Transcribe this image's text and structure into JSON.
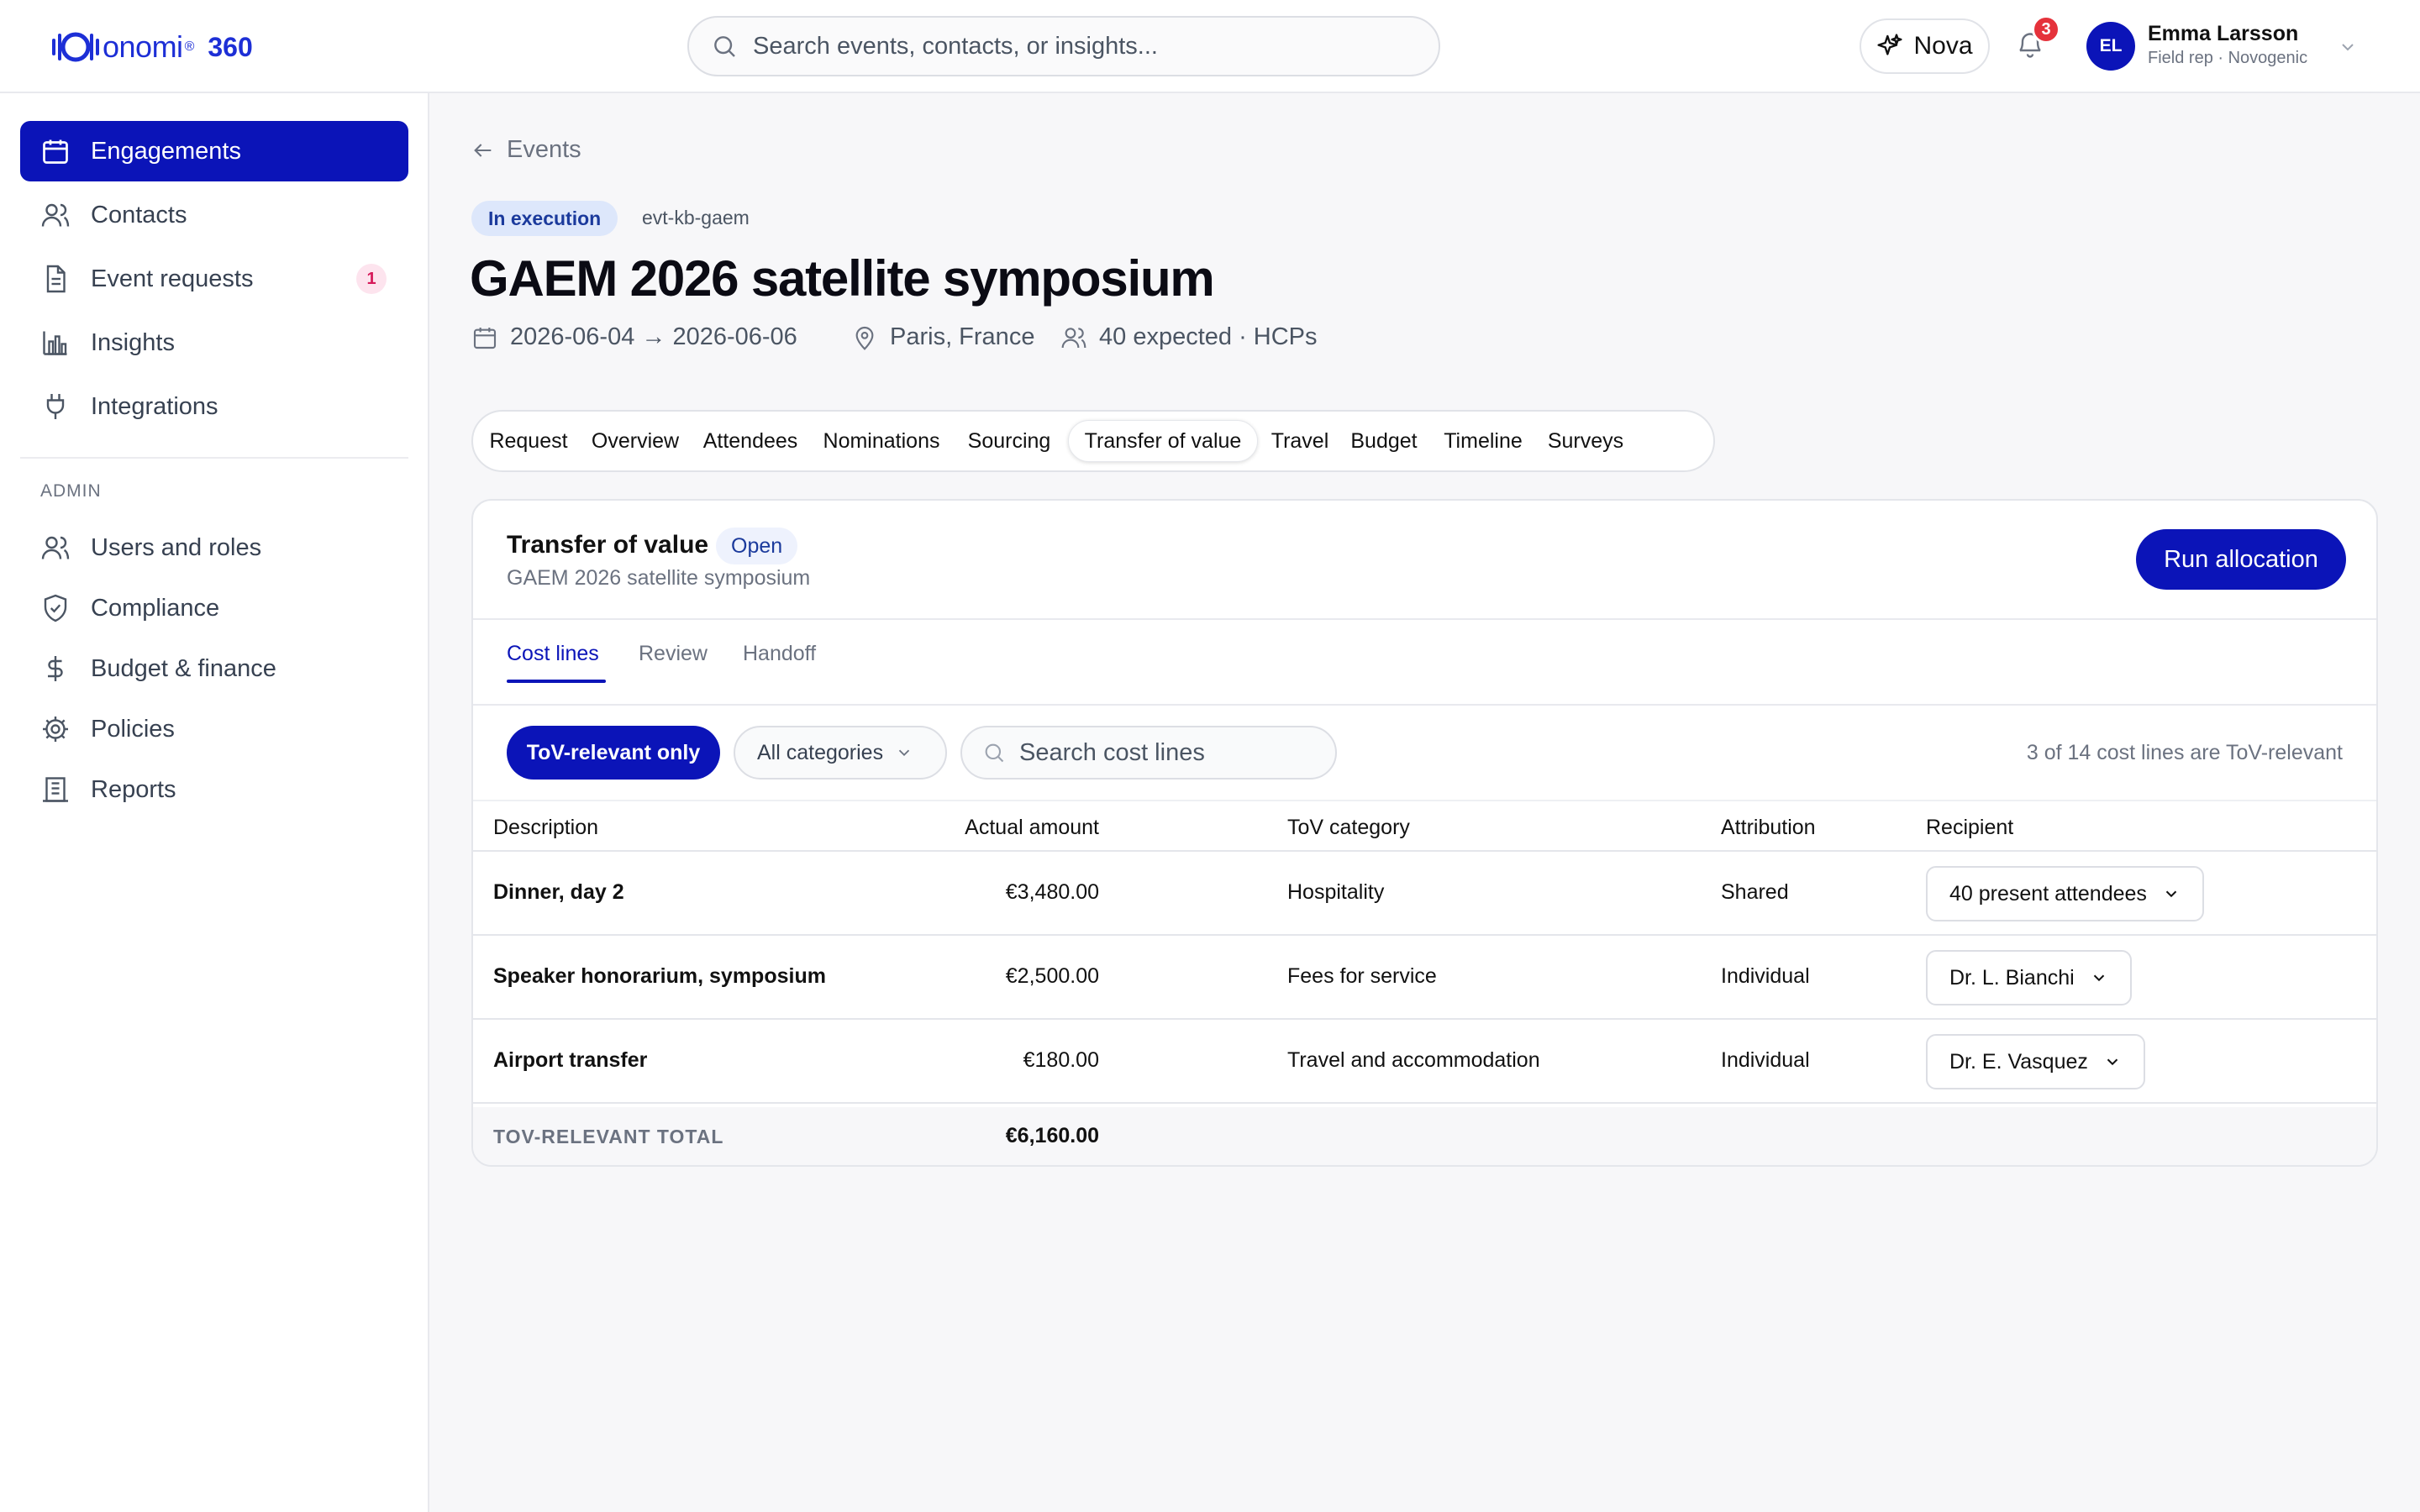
{
  "brand": {
    "name": "onomi",
    "product": "360",
    "accent": "#0b14b8",
    "logo_color": "#1d2fd6"
  },
  "search": {
    "placeholder": "Search events, contacts, or insights..."
  },
  "header": {
    "nova_label": "Nova",
    "notification_count": "3",
    "user": {
      "initials": "EL",
      "name": "Emma Larsson",
      "role": "Field rep · Novogenic"
    }
  },
  "sidebar": {
    "items": [
      {
        "label": "Engagements",
        "icon": "calendar-icon",
        "active": true
      },
      {
        "label": "Contacts",
        "icon": "users-icon"
      },
      {
        "label": "Event requests",
        "icon": "document-icon",
        "badge": "1"
      },
      {
        "label": "Insights",
        "icon": "bar-chart-icon"
      },
      {
        "label": "Integrations",
        "icon": "plug-icon"
      }
    ],
    "admin_heading": "ADMIN",
    "admin_items": [
      {
        "label": "Users and roles",
        "icon": "users-icon"
      },
      {
        "label": "Compliance",
        "icon": "shield-icon"
      },
      {
        "label": "Budget & finance",
        "icon": "dollar-icon"
      },
      {
        "label": "Policies",
        "icon": "gear-icon"
      },
      {
        "label": "Reports",
        "icon": "building-icon"
      }
    ]
  },
  "page": {
    "back_label": "Events",
    "status": "In execution",
    "event_id": "evt-kb-gaem",
    "title": "GAEM 2026 satellite symposium",
    "dates": "2026-06-04 → 2026-06-06",
    "location": "Paris, France",
    "attendance": "40 expected · HCPs",
    "tabs": [
      "Request",
      "Overview",
      "Attendees",
      "Nominations",
      "Sourcing",
      "Transfer of value",
      "Travel",
      "Budget",
      "Timeline",
      "Surveys"
    ],
    "active_tab": "Transfer of value"
  },
  "tov": {
    "title": "Transfer of value",
    "status": "Open",
    "subtitle": "GAEM 2026 satellite symposium",
    "run_button": "Run allocation",
    "subtabs": [
      "Cost lines",
      "Review",
      "Handoff"
    ],
    "filters": {
      "tov_only": "ToV-relevant only",
      "category_select": "All categories",
      "search_placeholder": "Search cost lines",
      "count_text": "3 of 14 cost lines are ToV-relevant"
    },
    "columns": [
      "Description",
      "Actual amount",
      "ToV category",
      "Attribution",
      "Recipient"
    ],
    "rows": [
      {
        "description": "Dinner, day 2",
        "amount": "€3,480.00",
        "category": "Hospitality",
        "attribution": "Shared",
        "recipient": "40 present attendees"
      },
      {
        "description": "Speaker honorarium, symposium",
        "amount": "€2,500.00",
        "category": "Fees for service",
        "attribution": "Individual",
        "recipient": "Dr. L. Bianchi"
      },
      {
        "description": "Airport transfer",
        "amount": "€180.00",
        "category": "Travel and accommodation",
        "attribution": "Individual",
        "recipient": "Dr. E. Vasquez"
      }
    ],
    "total_label": "TOV-RELEVANT TOTAL",
    "total_value": "€6,160.00"
  }
}
